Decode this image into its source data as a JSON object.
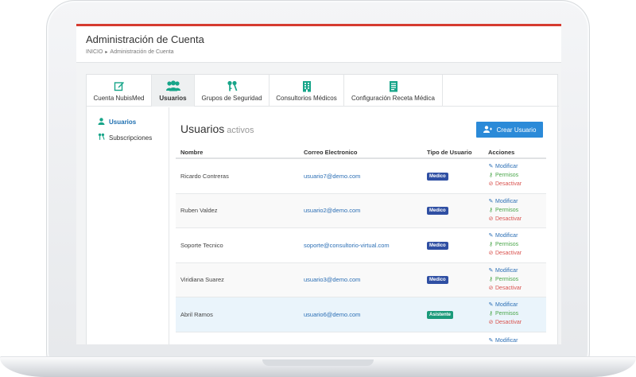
{
  "colors": {
    "accent_bar": "#d63b30",
    "primary": "#2b8ad8",
    "link": "#2c6fb5",
    "teal_icon": "#17a589",
    "badge_medico": "#2f4fa3",
    "badge_asistente": "#1b9a7a",
    "permisos": "#4aa64a",
    "desactivar": "#d9534f"
  },
  "header": {
    "title": "Administración de Cuenta",
    "breadcrumb": [
      "INICIO",
      "Administración de Cuenta"
    ]
  },
  "tabs": [
    {
      "label": "Cuenta NubisMed",
      "icon": "edit-icon",
      "active": false
    },
    {
      "label": "Usuarios",
      "icon": "users-icon",
      "active": true
    },
    {
      "label": "Grupos de Seguridad",
      "icon": "keys-icon",
      "active": false
    },
    {
      "label": "Consultorios Médicos",
      "icon": "building-icon",
      "active": false
    },
    {
      "label": "Configuración Receta Médica",
      "icon": "document-icon",
      "active": false
    }
  ],
  "sidemenu": [
    {
      "label": "Usuarios",
      "icon": "user-icon",
      "active": true
    },
    {
      "label": "Subscripciones",
      "icon": "keys-icon",
      "active": false
    }
  ],
  "content": {
    "title": "Usuarios",
    "subtitle": "activos",
    "create_button": "Crear Usuario"
  },
  "table": {
    "columns": [
      "Nombre",
      "Correo Electronico",
      "Tipo de Usuario",
      "Acciones"
    ],
    "actions": {
      "modify": "Modificar",
      "permissions": "Permisos",
      "deactivate": "Desactivar"
    },
    "rows": [
      {
        "name": "Ricardo Contreras",
        "email": "usuario7@demo.com",
        "type": "Medico"
      },
      {
        "name": "Ruben Valdez",
        "email": "usuario2@demo.com",
        "type": "Medico"
      },
      {
        "name": "Soporte Tecnico",
        "email": "soporte@consultorio-virtual.com",
        "type": "Medico"
      },
      {
        "name": "Viridiana Suarez",
        "email": "usuario3@demo.com",
        "type": "Medico"
      },
      {
        "name": "Abril Ramos",
        "email": "usuario6@demo.com",
        "type": "Asistente"
      }
    ],
    "partial_row_action": "Modificar"
  }
}
